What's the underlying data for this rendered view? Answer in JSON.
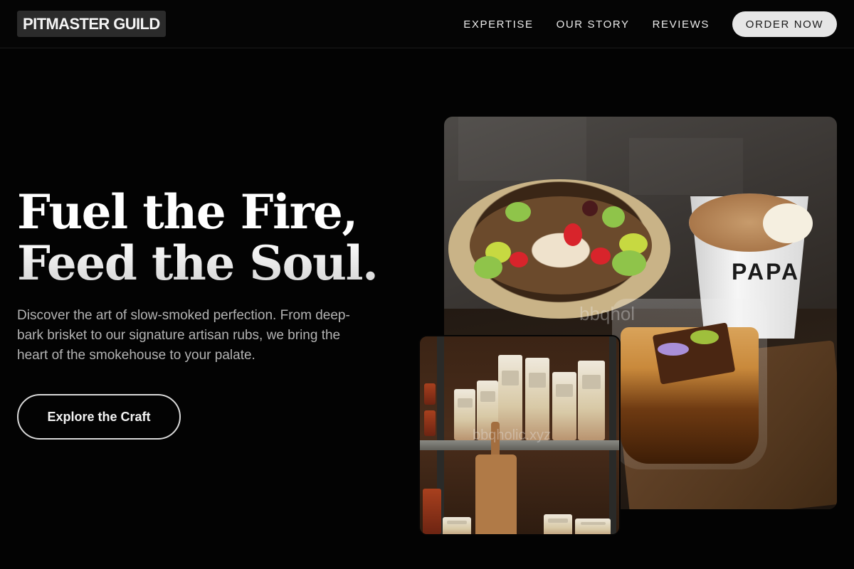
{
  "header": {
    "logo": "PITMASTER GUILD",
    "nav": [
      {
        "label": "EXPERTISE"
      },
      {
        "label": "OUR STORY"
      },
      {
        "label": "REVIEWS"
      }
    ],
    "order_button": "ORDER NOW"
  },
  "hero": {
    "title_line1": "Fuel the Fire,",
    "title_line2": "Feed the Soul.",
    "description": "Discover the art of slow-smoked perfection. From deep-bark brisket to our signature artisan rubs, we bring the heart of the smokehouse to your palate.",
    "cta": "Explore the Craft"
  },
  "images": {
    "main_photo": {
      "cup_text": "PAPA",
      "watermark": "bbqhol"
    },
    "shelf_photo": {
      "watermark": "bbqholic.xyz"
    }
  },
  "colors": {
    "background": "#030303",
    "button_light": "#e6e6e6",
    "text_muted": "#b3b3b3"
  }
}
